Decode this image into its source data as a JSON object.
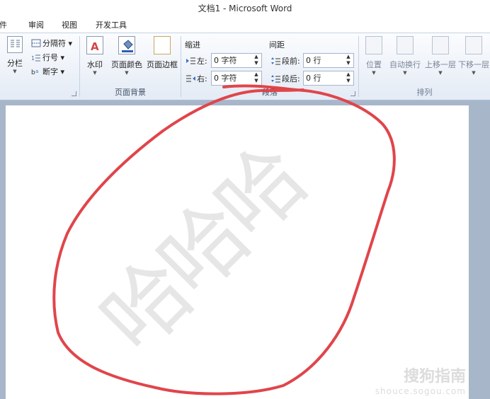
{
  "window": {
    "title": "文档1 - Microsoft Word"
  },
  "tabs": [
    "邮件",
    "审阅",
    "视图",
    "开发工具"
  ],
  "ribbon": {
    "page_setup": {
      "columns_label": "分栏",
      "breaks_label": "分隔符",
      "line_numbers_label": "行号",
      "hyphenation_label": "断字"
    },
    "page_background": {
      "group_label": "页面背景",
      "watermark_label": "水印",
      "page_color_label": "页面颜色",
      "page_borders_label": "页面边框"
    },
    "paragraph": {
      "group_label": "段落",
      "indent_header": "缩进",
      "spacing_header": "间距",
      "indent_left_label": "左:",
      "indent_left_value": "0 字符",
      "indent_right_label": "右:",
      "indent_right_value": "0 字符",
      "spacing_before_label": "段前:",
      "spacing_before_value": "0 行",
      "spacing_after_label": "段后:",
      "spacing_after_value": "0 行"
    },
    "arrange": {
      "group_label": "排列",
      "position_label": "位置",
      "wrap_text_label": "自动换行",
      "bring_forward_label": "上移一层",
      "send_backward_label": "下移一层"
    }
  },
  "document": {
    "watermark_text": "哈哈哈",
    "site_watermark_name": "搜狗指南",
    "site_watermark_url": "shouce.sogou.com"
  },
  "colors": {
    "annotation": "#e0454a",
    "ribbon_border": "#a9bcd6",
    "workspace": "#a8b6ca"
  }
}
